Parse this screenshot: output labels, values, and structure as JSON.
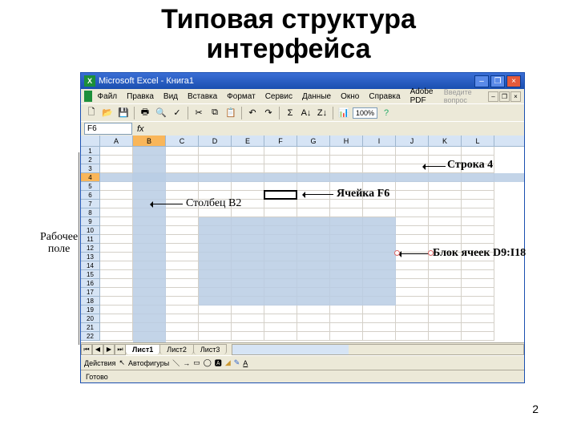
{
  "slide": {
    "title_l1": "Типовая структура",
    "title_l2": "интерфейса",
    "page": "2"
  },
  "window": {
    "title": "Microsoft Excel - Книга1"
  },
  "menu": [
    "Файл",
    "Правка",
    "Вид",
    "Вставка",
    "Формат",
    "Сервис",
    "Данные",
    "Окно",
    "Справка",
    "Adobe PDF"
  ],
  "help_placeholder": "Введите вопрос",
  "zoom": "100%",
  "name_box": "F6",
  "columns": [
    "A",
    "B",
    "C",
    "D",
    "E",
    "F",
    "G",
    "H",
    "I",
    "J",
    "K",
    "L"
  ],
  "row_count": 22,
  "sheets": [
    "Лист1",
    "Лист2",
    "Лист3"
  ],
  "draw_label": "Действия",
  "autoshapes": "Автофигуры",
  "status": "Готово",
  "annotations": {
    "row4": "Строка 4",
    "colB": "Столбец B2",
    "cellF6": "Ячейка F6",
    "block": "Блок ячеек D9:I18",
    "workfield_l1": "Рабочее",
    "workfield_l2": "поле"
  }
}
